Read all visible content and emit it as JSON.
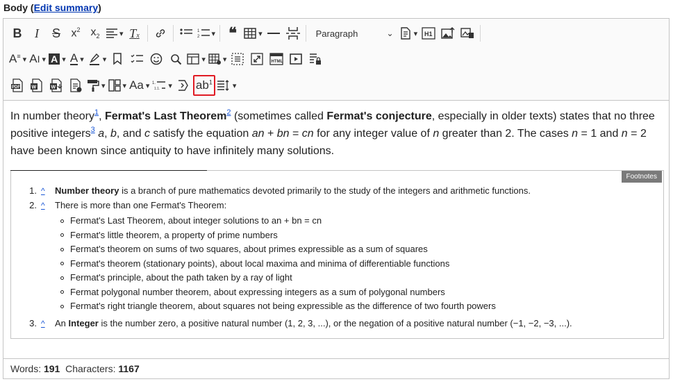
{
  "field": {
    "label": "Body",
    "open_paren": "(",
    "edit_summary_link": "Edit summary",
    "close_paren": ")"
  },
  "toolbar": {
    "paragraph_select": "Paragraph",
    "rows": [
      [
        "bold-icon",
        "italic-icon",
        "strikethrough-icon",
        "superscript-icon",
        "subscript-icon",
        "align-icon",
        "remove-format-icon",
        "link-icon",
        "bulleted-list-icon",
        "numbered-list-icon",
        "blockquote-icon",
        "table-icon",
        "horizontal-line-icon",
        "page-break-icon",
        "paragraph-select",
        "source-icon",
        "heading-h1-icon",
        "image-upload-icon",
        "media-icon"
      ],
      [
        "font-family-icon",
        "font-size-icon",
        "font-background-icon",
        "font-color-icon",
        "highlight-icon",
        "bookmark-icon",
        "todo-list-icon",
        "emoji-icon",
        "find-replace-icon",
        "template-icon",
        "insert-table-icon",
        "show-blocks-icon",
        "fullscreen-icon",
        "html-embed-icon",
        "media-embed-icon",
        "restricted-editing-icon"
      ],
      [
        "export-pdf-icon",
        "export-word-icon",
        "import-word-icon",
        "document-outline-icon",
        "format-painter-icon",
        "layout-table-icon",
        "case-change-icon",
        "multilevel-list-icon",
        "ai-assistant-icon",
        "footnote-icon",
        "line-height-icon"
      ]
    ]
  },
  "content": {
    "p_t1": "In number theory",
    "p_ref1": "1",
    "p_t2": ", ",
    "p_b1": "Fermat's Last Theorem",
    "p_ref2": "2",
    "p_t3": " (sometimes called ",
    "p_b2": "Fermat's conjecture",
    "p_t4": ", especially in older texts) states that no three positive integers",
    "p_ref3": "3",
    "p_t5": " ",
    "p_i1": "a",
    "p_t6": ", ",
    "p_i2": "b",
    "p_t7": ", and ",
    "p_i3": "c",
    "p_t8": " satisfy the equation ",
    "p_i4": "an",
    "p_t9": " + ",
    "p_i5": "bn",
    "p_t10": " = ",
    "p_i6": "cn",
    "p_t11": " for any integer value of ",
    "p_i7": "n",
    "p_t12": " greater than 2. The cases ",
    "p_i8": "n",
    "p_t13": " = 1 and ",
    "p_i9": "n",
    "p_t14": " = 2 have been known since antiquity to have infinitely many solutions.",
    "footnotes_badge": "Footnotes",
    "footnotes": [
      {
        "num": "1.",
        "back": "^",
        "bold": "Number theory",
        "text": " is a branch of pure mathematics devoted primarily to the study of the integers and arithmetic functions."
      },
      {
        "num": "2.",
        "back": "^",
        "bold": "",
        "text": "There is more than one Fermat's Theorem:",
        "sub": [
          "Fermat's Last Theorem, about integer solutions to an + bn = cn",
          "Fermat's little theorem, a property of prime numbers",
          "Fermat's theorem on sums of two squares, about primes expressible as a sum of squares",
          "Fermat's theorem (stationary points), about local maxima and minima of differentiable functions",
          "Fermat's principle, about the path taken by a ray of light",
          "Fermat polygonal number theorem, about expressing integers as a sum of polygonal numbers",
          "Fermat's right triangle theorem, about squares not being expressible as the difference of two fourth powers"
        ]
      },
      {
        "num": "3.",
        "back": "^",
        "pre": "An ",
        "bold": "Integer",
        "text": " is the number zero, a positive natural number (1, 2, 3, ...), or the negation of a positive natural number (−1, −2, −3, ...)."
      }
    ]
  },
  "status": {
    "words_label": "Words:",
    "words_value": "191",
    "chars_label": "Characters:",
    "chars_value": "1167"
  },
  "colors": {
    "highlight_border": "#e01b24",
    "link": "#1a57d6",
    "badge": "#7a7a7a"
  }
}
